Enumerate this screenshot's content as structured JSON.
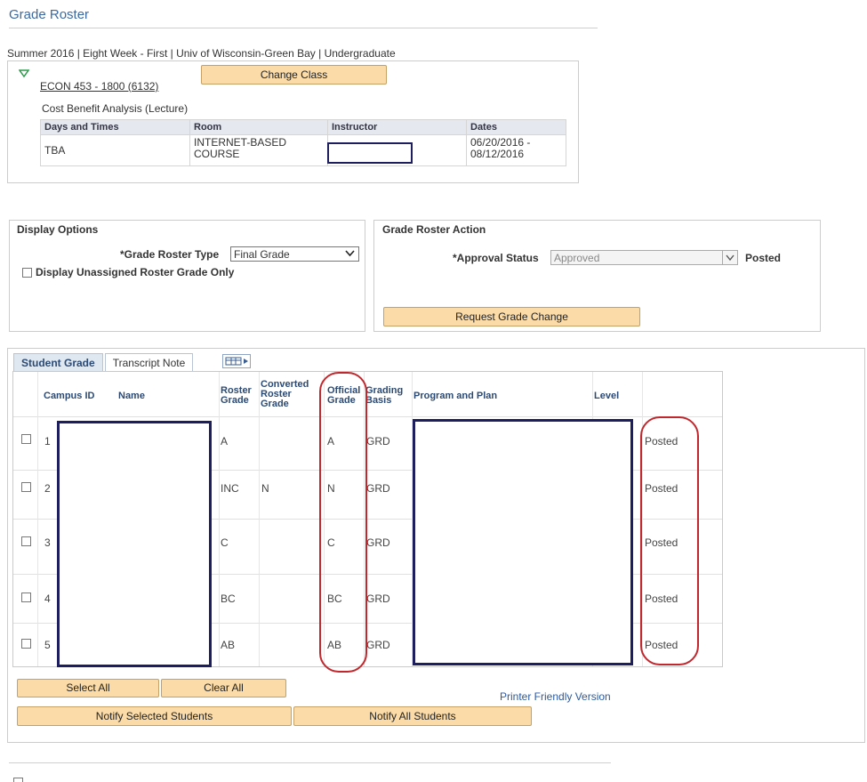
{
  "page": {
    "title": "Grade Roster",
    "term_line": "Summer 2016 | Eight Week - First | Univ of Wisconsin-Green Bay | Undergraduate"
  },
  "class": {
    "change_class_label": "Change Class",
    "class_link": "ECON 453 - 1800 (6132)",
    "description": "Cost Benefit Analysis (Lecture)",
    "columns": [
      "Days and Times",
      "Room",
      "Instructor",
      "Dates"
    ],
    "row": {
      "days_times": "TBA",
      "room": "INTERNET-BASED COURSE",
      "instructor": "",
      "dates": "06/20/2016 - 08/12/2016"
    }
  },
  "display_options": {
    "header": "Display Options",
    "roster_type_label": "*Grade Roster Type",
    "roster_type_value": "Final Grade",
    "unassigned_label": "Display Unassigned Roster Grade Only"
  },
  "roster_action": {
    "header": "Grade Roster Action",
    "approval_label": "*Approval Status",
    "approval_value": "Approved",
    "status": "Posted",
    "request_change_label": "Request Grade Change"
  },
  "tabs": [
    "Student Grade",
    "Transcript Note"
  ],
  "grid": {
    "headers": {
      "campus_id": "Campus ID",
      "name": "Name",
      "roster_grade": [
        "Roster",
        "Grade"
      ],
      "converted": [
        "Converted",
        "Roster",
        "Grade"
      ],
      "official": [
        "Official",
        "Grade"
      ],
      "grading": [
        "Grading",
        "Basis"
      ],
      "program": "Program and Plan",
      "level": "Level"
    },
    "rows": [
      {
        "num": "1",
        "roster": "A",
        "converted": "",
        "official": "A",
        "basis": "GRD",
        "status": "Posted"
      },
      {
        "num": "2",
        "roster": "INC",
        "converted": "N",
        "official": "N",
        "basis": "GRD",
        "status": "Posted"
      },
      {
        "num": "3",
        "roster": "C",
        "converted": "",
        "official": "C",
        "basis": "GRD",
        "status": "Posted"
      },
      {
        "num": "4",
        "roster": "BC",
        "converted": "",
        "official": "BC",
        "basis": "GRD",
        "status": "Posted"
      },
      {
        "num": "5",
        "roster": "AB",
        "converted": "",
        "official": "AB",
        "basis": "GRD",
        "status": "Posted"
      }
    ]
  },
  "actions": {
    "select_all": "Select All",
    "clear_all": "Clear All",
    "printer_friendly": "Printer Friendly Version",
    "notify_selected": "Notify Selected Students",
    "notify_all": "Notify All Students"
  },
  "colors": {
    "button_bg": "#fbdba7",
    "title_blue": "#3b6aa0",
    "annotation_red": "#c0282d",
    "redaction_navy": "#1e1e5e"
  }
}
